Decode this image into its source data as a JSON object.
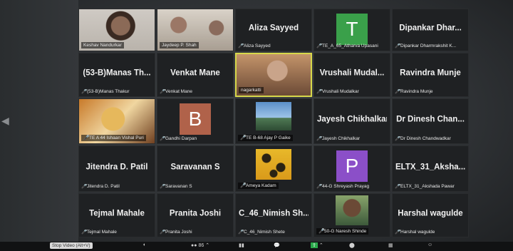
{
  "participants": [
    {
      "tile_type": "video",
      "name": "Keshav Nandurkar"
    },
    {
      "tile_type": "video",
      "name": "Jaydeep P. Shah"
    },
    {
      "tile_type": "name",
      "display": "Aliza Sayyed",
      "name": "Aliza Sayyed"
    },
    {
      "tile_type": "avatar",
      "letter": "T",
      "color": "#3aa04a",
      "name": "TE_A_65_Atharva Upasani"
    },
    {
      "tile_type": "name",
      "display": "Dipankar Dhar...",
      "name": "Dipankar Dharmrakshit K..."
    },
    {
      "tile_type": "name",
      "display": "(53-B)Manas Th...",
      "name": "(53-B)Manas Thakur"
    },
    {
      "tile_type": "name",
      "display": "Venkat Mane",
      "name": "Venkat Mane"
    },
    {
      "tile_type": "video",
      "name": "nagarkatti",
      "active": true
    },
    {
      "tile_type": "name",
      "display": "Vrushali Mudal...",
      "name": "Vrushali Mudalkar"
    },
    {
      "tile_type": "name",
      "display": "Ravindra Munje",
      "name": "Ravindra Munje"
    },
    {
      "tile_type": "video",
      "name": "TE A 44 Ishaan Vishal Puri"
    },
    {
      "tile_type": "avatar",
      "letter": "B",
      "color": "#b0624a",
      "name": "Gandhi Darpan"
    },
    {
      "tile_type": "video",
      "name": "TE B-68 Ajay P Gaike"
    },
    {
      "tile_type": "name",
      "display": "Jayesh Chikhalkar",
      "name": "Jayesh Chikhalkar"
    },
    {
      "tile_type": "name",
      "display": "Dr Dinesh Chan...",
      "name": "Dr Dinesh Chandwadkar"
    },
    {
      "tile_type": "name",
      "display": "Jitendra D. Patil",
      "name": "Jitendra D. Patil"
    },
    {
      "tile_type": "name",
      "display": "Saravanan S",
      "name": "Saravanan S"
    },
    {
      "tile_type": "video",
      "name": "Ameya Kadam"
    },
    {
      "tile_type": "avatar",
      "letter": "P",
      "color": "#8b4fc8",
      "name": "44-G Shreyash Prayag"
    },
    {
      "tile_type": "name",
      "display": "ELTX_31_Aksha...",
      "name": "ELTX_31_Akshada Pawar"
    },
    {
      "tile_type": "name",
      "display": "Tejmal Mahale",
      "name": "Tejmal Mahale"
    },
    {
      "tile_type": "name",
      "display": "Pranita Joshi",
      "name": "Pranita Joshi"
    },
    {
      "tile_type": "name",
      "display": "C_46_Nimish Sh...",
      "name": "C_46_Nimish Shete"
    },
    {
      "tile_type": "video",
      "name": "50-G Naresh Shinde"
    },
    {
      "tile_type": "name",
      "display": "Harshal wagulde",
      "name": "Harshal wagulde"
    }
  ],
  "toolbar": {
    "tooltip": "Stop Video (Alt+V)",
    "participants_count": "86"
  }
}
